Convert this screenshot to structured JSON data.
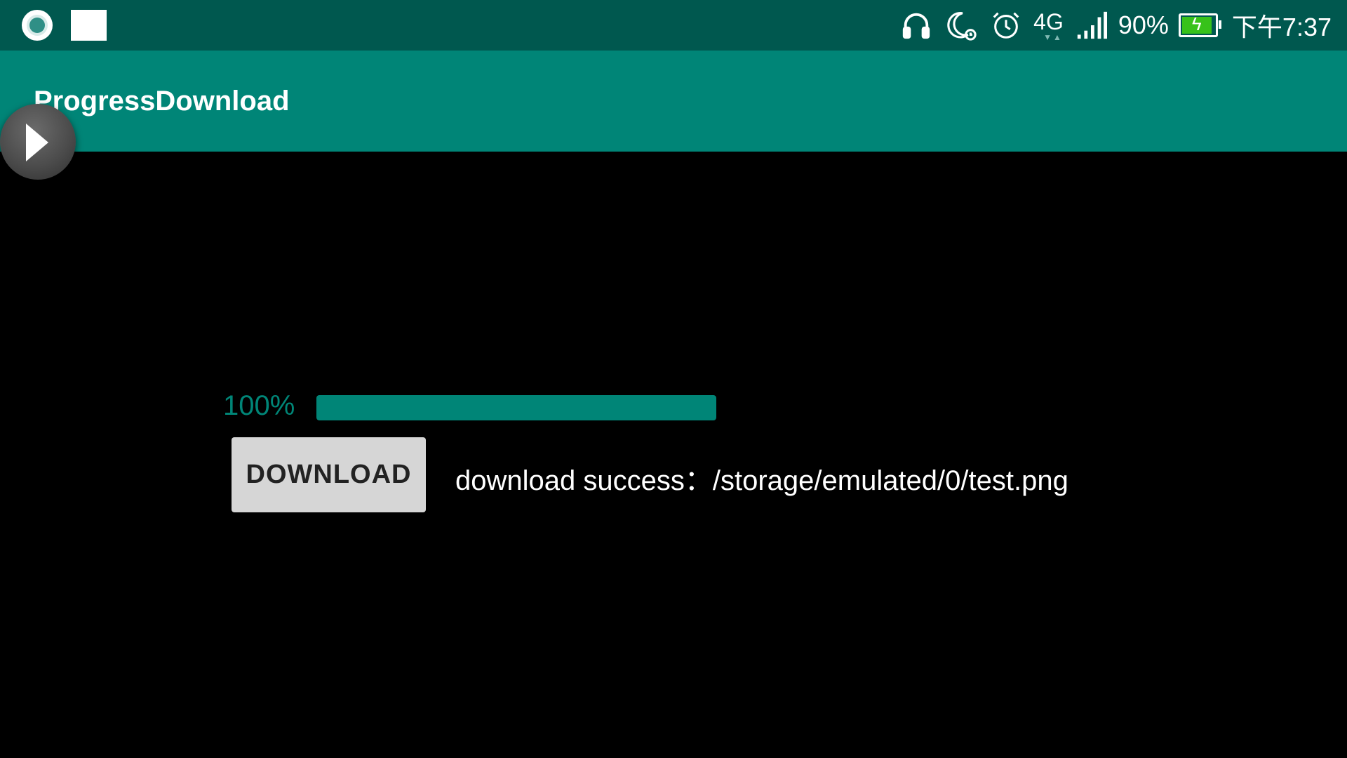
{
  "status_bar": {
    "left_icons": [
      "screen-record-icon",
      "white-square-icon"
    ],
    "network": "4G",
    "battery_percent": "90%",
    "time": "下午7:37",
    "icons": [
      "headphones-icon",
      "moon-alarm-icon",
      "alarm-clock-icon",
      "signal-bars-icon",
      "battery-charging-icon"
    ],
    "colors": {
      "background": "#00584f",
      "battery_fill": "#37c21a"
    }
  },
  "toolbar": {
    "title": "ProgressDownload",
    "color": "#008577"
  },
  "floating_button": {
    "icon": "play-icon"
  },
  "progress": {
    "label": "100%",
    "value": 1.0,
    "color": "#008577"
  },
  "download_button": {
    "label": "DOWNLOAD"
  },
  "status_message": "download success：/storage/emulated/0/test.png"
}
